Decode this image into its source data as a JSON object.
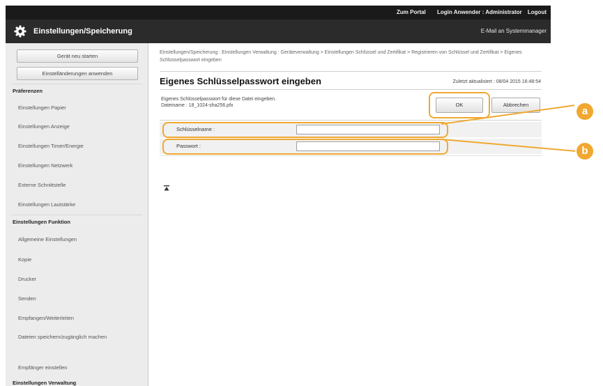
{
  "header": {
    "portal_link": "Zum Portal",
    "login_user": "Login Anwender : Administrator",
    "logout_link": "Logout",
    "app_title": "Einstellungen/Speicherung",
    "mail_link": "E-Mail an Systemmanager"
  },
  "sidebar": {
    "restart_button": "Gerät neu starten",
    "apply_button": "Einstelländerungen anwenden",
    "section_preferences": "Präferenzen",
    "preferences_items": [
      "Einstellungen Papier",
      "Einstellungen Anzeige",
      "Einstellungen Timer/Energie",
      "Einstellungen Netzwerk",
      "Externe Schnittstelle",
      "Einstellungen Lautstärke"
    ],
    "section_functions": "Einstellungen Funktion",
    "function_items": [
      "Allgemeine Einstellungen",
      "Kopie",
      "Drucker",
      "Senden",
      "Empfangen/Weiterleiten",
      "Dateien speichern/zugänglich machen",
      "Empfänger einstellen"
    ],
    "footer_cut": "Einstellungen Verwaltung"
  },
  "main": {
    "breadcrumb": "Einstellungen/Speicherung : Einstellungen Verwaltung : Geräteverwaltung > Einstellungen Schlüssel und Zertifikat > Registrieren von Schlüssel und Zertifikat > Eigenes Schlüsselpasswort eingeben",
    "page_title": "Eigenes Schlüsselpasswort eingeben",
    "last_updated": "Zuletzt aktualisiert : 08/04 2015 16:48:54",
    "description_line1": "Eigenes Schlüsselpasswort für diese Datei eingeben.",
    "description_line2": "Dateiname : 18_1024-sha256.pfx",
    "ok_button": "OK",
    "cancel_button": "Abbrechen",
    "key_name_label": "Schlüsselname :",
    "key_name_value": "",
    "password_label": "Passwort :",
    "password_value": ""
  },
  "callouts": {
    "a": "a",
    "b": "b"
  },
  "colors": {
    "callout": "#f0a830",
    "header_bg": "#1a1a1a",
    "titlebar_bg": "#2b2b2b",
    "sidebar_bg": "#ececec"
  },
  "icons": {
    "app": "gear-icon",
    "scroll_top": "scroll-top-icon"
  }
}
